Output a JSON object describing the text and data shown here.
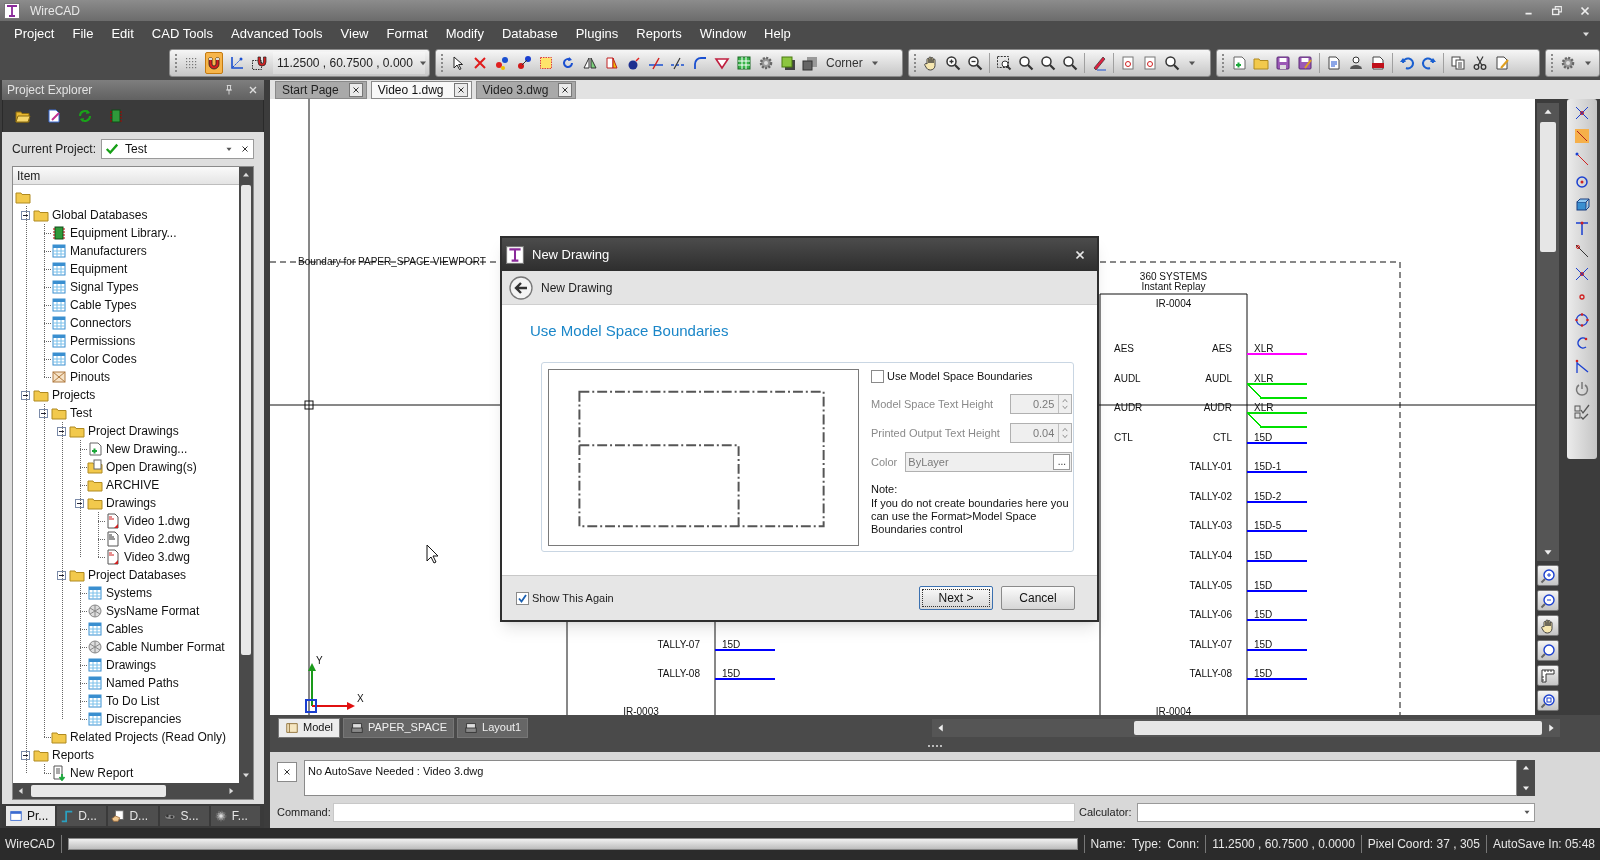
{
  "window": {
    "title": "WireCAD"
  },
  "menu": [
    "Project",
    "File",
    "Edit",
    "CAD Tools",
    "Advanced Tools",
    "View",
    "Format",
    "Modify",
    "Database",
    "Plugins",
    "Reports",
    "Window",
    "Help"
  ],
  "toolbar": {
    "snap_magnet": {
      "on": true
    },
    "coordinates": "11.2500 , 60.7500 , 0.000",
    "corner_mode": "Corner"
  },
  "project_explorer": {
    "title": "Project Explorer",
    "current_project_label": "Current Project:",
    "current_project": "Test",
    "tree_header": "Item",
    "tree": [
      {
        "kind": "folder",
        "children": [
          {
            "label": "Global Databases",
            "kind": "folder",
            "expanded": true,
            "children": [
              {
                "label": "Equipment Library...",
                "kind": "equipment"
              },
              {
                "label": "Manufacturers",
                "kind": "table"
              },
              {
                "label": "Equipment",
                "kind": "table"
              },
              {
                "label": "Signal Types",
                "kind": "table"
              },
              {
                "label": "Cable Types",
                "kind": "table"
              },
              {
                "label": "Connectors",
                "kind": "table"
              },
              {
                "label": "Permissions",
                "kind": "table"
              },
              {
                "label": "Color Codes",
                "kind": "table"
              },
              {
                "label": "Pinouts",
                "kind": "pinout"
              }
            ]
          },
          {
            "label": "Projects",
            "kind": "folder",
            "expanded": true,
            "children": [
              {
                "label": "Test",
                "kind": "folder",
                "expanded": true,
                "children": [
                  {
                    "label": "Project Drawings",
                    "kind": "folder",
                    "expanded": true,
                    "children": [
                      {
                        "label": "New Drawing...",
                        "kind": "new-drawing"
                      },
                      {
                        "label": "Open Drawing(s)",
                        "kind": "open-drawing"
                      },
                      {
                        "label": "ARCHIVE",
                        "kind": "folder"
                      },
                      {
                        "label": "Drawings",
                        "kind": "folder",
                        "expanded": true,
                        "children": [
                          {
                            "label": "Video 1.dwg",
                            "kind": "dwg"
                          },
                          {
                            "label": "Video 2.dwg",
                            "kind": "dwg-plain"
                          },
                          {
                            "label": "Video 3.dwg",
                            "kind": "dwg"
                          }
                        ]
                      }
                    ]
                  },
                  {
                    "label": "Project Databases",
                    "kind": "folder",
                    "expanded": true,
                    "children": [
                      {
                        "label": "Systems",
                        "kind": "table"
                      },
                      {
                        "label": "SysName Format",
                        "kind": "format"
                      },
                      {
                        "label": "Cables",
                        "kind": "table"
                      },
                      {
                        "label": "Cable Number Format",
                        "kind": "format"
                      },
                      {
                        "label": "Drawings",
                        "kind": "table"
                      },
                      {
                        "label": "Named Paths",
                        "kind": "table"
                      },
                      {
                        "label": "To Do List",
                        "kind": "table"
                      },
                      {
                        "label": "Discrepancies",
                        "kind": "table"
                      }
                    ]
                  }
                ]
              },
              {
                "label": "Related Projects (Read Only)",
                "kind": "folder"
              }
            ]
          },
          {
            "label": "Reports",
            "kind": "folder",
            "expanded": true,
            "children": [
              {
                "label": "New Report",
                "kind": "report"
              }
            ]
          }
        ]
      }
    ],
    "tabs": [
      {
        "label": "Pr...",
        "selected": true
      },
      {
        "label": "D...",
        "selected": false
      },
      {
        "label": "D...",
        "selected": false
      },
      {
        "label": "S...",
        "selected": false
      },
      {
        "label": "F...",
        "selected": false
      }
    ]
  },
  "document_tabs": [
    {
      "label": "Start Page",
      "selected": false
    },
    {
      "label": "Video 1.dwg",
      "selected": true
    },
    {
      "label": "Video 3.dwg",
      "selected": false
    }
  ],
  "canvas": {
    "boundary_label": "Boundary for PAPER_SPACE VIEWPORT",
    "devices": [
      {
        "next_id": "IR-0003",
        "ports": [
          {
            "right": "TALLY-07",
            "cable": "15D",
            "color": "#0000ff",
            "kind": "single"
          },
          {
            "right": "TALLY-08",
            "cable": "15D",
            "color": "#0000ff",
            "kind": "single"
          }
        ]
      },
      {
        "manufacturer": "360 SYSTEMS",
        "model": "Instant Replay",
        "id": "IR-0004",
        "next_id": "IR-0004",
        "ports": [
          {
            "left": "AES",
            "right": "AES",
            "cable": "XLR",
            "color": "#ff00ff",
            "kind": "single"
          },
          {
            "left": "AUDL",
            "right": "AUDL",
            "cable": "XLR",
            "color": "#00e000",
            "kind": "split"
          },
          {
            "left": "AUDR",
            "right": "AUDR",
            "cable": "XLR",
            "color": "#00e000",
            "kind": "split"
          },
          {
            "left": "CTL",
            "right": "CTL",
            "cable": "15D",
            "color": "#0000ff",
            "kind": "single"
          },
          {
            "right": "TALLY-01",
            "cable": "15D-1",
            "color": "#0000ff",
            "kind": "single"
          },
          {
            "right": "TALLY-02",
            "cable": "15D-2",
            "color": "#0000ff",
            "kind": "single"
          },
          {
            "right": "TALLY-03",
            "cable": "15D-5",
            "color": "#0000ff",
            "kind": "single"
          },
          {
            "right": "TALLY-04",
            "cable": "15D",
            "color": "#0000ff",
            "kind": "single"
          },
          {
            "right": "TALLY-05",
            "cable": "15D",
            "color": "#0000ff",
            "kind": "single"
          },
          {
            "right": "TALLY-06",
            "cable": "15D",
            "color": "#0000ff",
            "kind": "single"
          },
          {
            "right": "TALLY-07",
            "cable": "15D",
            "color": "#0000ff",
            "kind": "single"
          },
          {
            "right": "TALLY-08",
            "cable": "15D",
            "color": "#0000ff",
            "kind": "single"
          }
        ]
      }
    ],
    "axes": {
      "y_label": "Y",
      "x_label": "X"
    }
  },
  "layout_tabs": [
    {
      "label": "Model",
      "selected": true
    },
    {
      "label": "PAPER_SPACE",
      "selected": false
    },
    {
      "label": "Layout1",
      "selected": false
    }
  ],
  "output": {
    "message": "No AutoSave Needed : Video 3.dwg",
    "command_label": "Command:",
    "calculator_label": "Calculator:"
  },
  "status_bar": {
    "app": "WireCAD",
    "progress": {
      "level": 0
    },
    "name_label": "Name:",
    "type_label": "Type:",
    "conn_label": "Conn:",
    "coordinates": "11.2500 , 60.7500 , 0.0000",
    "pixel_coord": "Pixel Coord: 37 , 305",
    "autosave": "AutoSave In: 05:48"
  },
  "dialog": {
    "title": "New Drawing",
    "step": "New Drawing",
    "heading": "Use Model Space Boundaries",
    "use_boundaries": {
      "label": "Use Model Space Boundaries",
      "checked": false
    },
    "fields": [
      {
        "label": "Model Space Text Height",
        "value": "0.25",
        "kind": "spin",
        "disabled": true
      },
      {
        "label": "Printed Output Text Height",
        "value": "0.04",
        "kind": "spin",
        "disabled": true
      },
      {
        "label": "Color",
        "value": "ByLayer",
        "kind": "browse",
        "button": "...",
        "disabled": true
      }
    ],
    "note_label": "Note:",
    "note": "If you do not create boundaries here you can use the Format>Model Space Boundaries control",
    "show_again": {
      "label": "Show This Again",
      "checked": true
    },
    "buttons": [
      {
        "label": "Next >",
        "default": true
      },
      {
        "label": "Cancel",
        "default": false
      }
    ]
  }
}
